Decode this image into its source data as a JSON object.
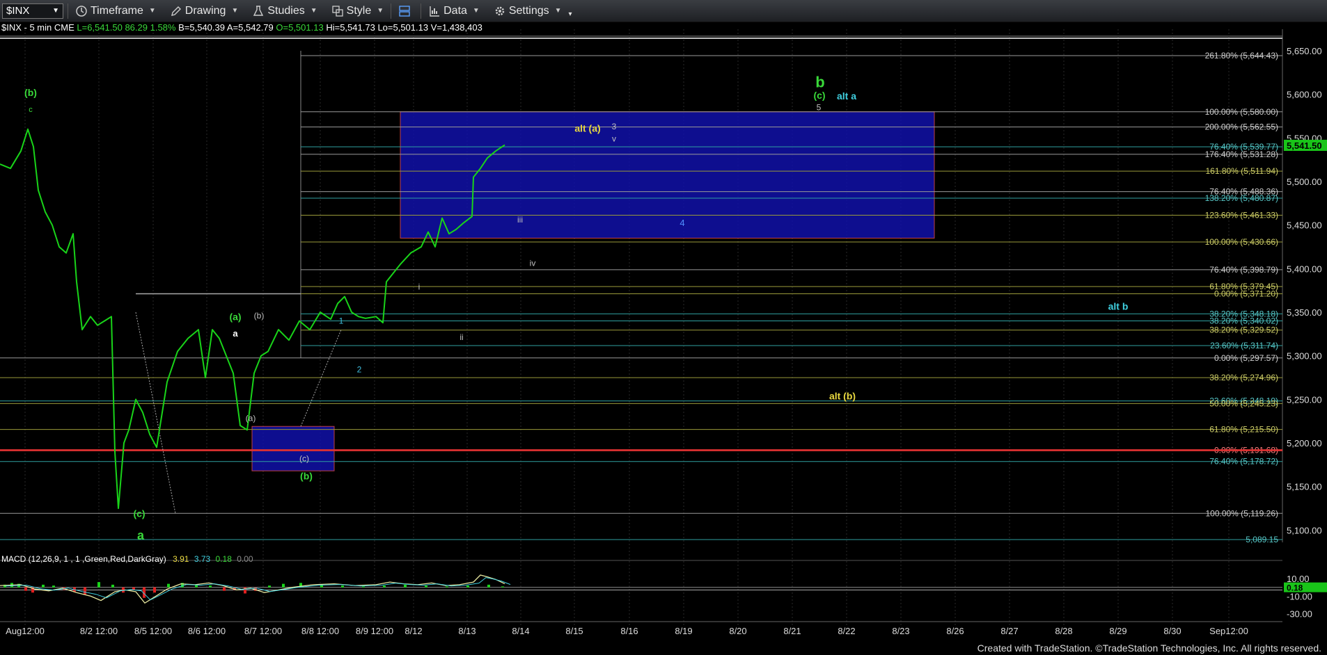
{
  "toolbar": {
    "symbol": "$INX",
    "items": [
      {
        "name": "timeframe",
        "label": "Timeframe",
        "icon": "clock-icon"
      },
      {
        "name": "drawing",
        "label": "Drawing",
        "icon": "pencil-icon"
      },
      {
        "name": "studies",
        "label": "Studies",
        "icon": "flask-icon"
      },
      {
        "name": "style",
        "label": "Style",
        "icon": "style-icon"
      },
      {
        "name": "data",
        "label": "Data",
        "icon": "bar-chart-icon"
      },
      {
        "name": "settings",
        "label": "Settings",
        "icon": "gear-icon"
      }
    ]
  },
  "infobar": {
    "symbol": "$INX - 5 min CME",
    "last": "L=6,541.50",
    "change": "86.29",
    "pct": "1.58%",
    "bid": "B=5,540.39",
    "ask": "A=5,542.79",
    "open": "O=5,501.13",
    "high": "Hi=5,541.73",
    "low": "Lo=5,501.13",
    "vol": "V=1,438,403"
  },
  "macd": {
    "label": "MACD (12,26,9, 1 , 1 ,Green,Red,DarkGray)",
    "v1": "3.91",
    "v2": "3.73",
    "v3": "0.18",
    "v4": "0.00"
  },
  "footer": "Created with TradeStation. ©TradeStation Technologies, Inc. All rights reserved.",
  "chart_data": {
    "type": "line",
    "ylim": [
      5072,
      5668
    ],
    "price_ticks": [
      5100,
      5150,
      5200,
      5250,
      5300,
      5350,
      5400,
      5450,
      5500,
      5550,
      5600,
      5650
    ],
    "price_tick_labels": [
      "5,100.00",
      "5,150.00",
      "5,200.00",
      "5,250.00",
      "5,300.00",
      "5,350.00",
      "5,400.00",
      "5,450.00",
      "5,500.00",
      "5,550.00",
      "5,600.00",
      "5,650.00"
    ],
    "last_price": {
      "value": 5541.5,
      "label": "5,541.50"
    },
    "date_labels": [
      "Aug12:00",
      "8/2 12:00",
      "8/5 12:00",
      "8/6 12:00",
      "8/7 12:00",
      "8/8 12:00",
      "8/9 12:00",
      "8/12",
      "8/13",
      "8/14",
      "8/15",
      "8/16",
      "8/19",
      "8/20",
      "8/21",
      "8/22",
      "8/23",
      "8/26",
      "8/27",
      "8/28",
      "8/29",
      "8/30",
      "Sep12:00"
    ],
    "price_series": [
      [
        0,
        5520
      ],
      [
        15,
        5515
      ],
      [
        30,
        5535
      ],
      [
        40,
        5560
      ],
      [
        48,
        5540
      ],
      [
        55,
        5490
      ],
      [
        65,
        5465
      ],
      [
        75,
        5450
      ],
      [
        85,
        5425
      ],
      [
        95,
        5418
      ],
      [
        105,
        5440
      ],
      [
        110,
        5385
      ],
      [
        118,
        5330
      ],
      [
        130,
        5345
      ],
      [
        140,
        5335
      ],
      [
        150,
        5340
      ],
      [
        160,
        5345
      ],
      [
        165,
        5190
      ],
      [
        170,
        5125
      ],
      [
        178,
        5200
      ],
      [
        185,
        5215
      ],
      [
        195,
        5250
      ],
      [
        205,
        5235
      ],
      [
        215,
        5210
      ],
      [
        225,
        5195
      ],
      [
        240,
        5270
      ],
      [
        255,
        5305
      ],
      [
        270,
        5320
      ],
      [
        285,
        5330
      ],
      [
        295,
        5275
      ],
      [
        305,
        5330
      ],
      [
        315,
        5320
      ],
      [
        325,
        5300
      ],
      [
        335,
        5280
      ],
      [
        345,
        5220
      ],
      [
        355,
        5215
      ],
      [
        365,
        5280
      ],
      [
        375,
        5300
      ],
      [
        385,
        5305
      ],
      [
        400,
        5330
      ],
      [
        415,
        5318
      ],
      [
        430,
        5340
      ],
      [
        445,
        5330
      ],
      [
        460,
        5350
      ],
      [
        475,
        5342
      ],
      [
        485,
        5360
      ],
      [
        495,
        5368
      ],
      [
        505,
        5350
      ],
      [
        515,
        5345
      ],
      [
        525,
        5343
      ],
      [
        540,
        5345
      ],
      [
        550,
        5338
      ],
      [
        555,
        5385
      ],
      [
        565,
        5395
      ],
      [
        575,
        5405
      ],
      [
        590,
        5418
      ],
      [
        605,
        5425
      ],
      [
        615,
        5442
      ],
      [
        625,
        5425
      ],
      [
        635,
        5458
      ],
      [
        645,
        5440
      ],
      [
        655,
        5445
      ],
      [
        665,
        5452
      ],
      [
        678,
        5460
      ],
      [
        680,
        5505
      ],
      [
        690,
        5515
      ],
      [
        700,
        5527
      ],
      [
        712,
        5535
      ],
      [
        725,
        5542
      ]
    ],
    "fib_levels": [
      {
        "label": "261.80% (5,644.43)",
        "value": 5644.43,
        "color": "#9a9a9a"
      },
      {
        "label": "100.00% (5,580.00)",
        "value": 5580.0,
        "color": "#9a9a9a"
      },
      {
        "label": "200.00% (5,562.55)",
        "value": 5562.55,
        "color": "#9a9a9a"
      },
      {
        "label": "76.40% (5,539.77)",
        "value": 5539.77,
        "color": "#2fa0a0"
      },
      {
        "label": "176.40% (5,531.28)",
        "value": 5531.28,
        "color": "#9a9a9a"
      },
      {
        "label": "161.80% (5,511.94)",
        "value": 5511.94,
        "color": "#9a9a3a"
      },
      {
        "label": "76.40% (5,488.36)",
        "value": 5488.36,
        "color": "#9a9a9a"
      },
      {
        "label": "138.20% (5,480.87)",
        "value": 5480.87,
        "color": "#2fa0a0"
      },
      {
        "label": "123.60% (5,461.33)",
        "value": 5461.33,
        "color": "#9a9a3a"
      },
      {
        "label": "100.00% (5,430.66)",
        "value": 5430.66,
        "color": "#9a9a3a"
      },
      {
        "label": "76.40% (5,398.79)",
        "value": 5398.79,
        "color": "#9a9a9a"
      },
      {
        "label": "61.80% (5,379.45)",
        "value": 5379.45,
        "color": "#9a9a3a"
      },
      {
        "label": "0.00% (5,371.20)",
        "value": 5371.2,
        "color": "#9a9a3a"
      },
      {
        "label": "38.20% (5,348.18)",
        "value": 5348.18,
        "color": "#2fa0a0"
      },
      {
        "label": "38.20% (5,340.02)",
        "value": 5340.02,
        "color": "#2fa0a0"
      },
      {
        "label": "38.20% (5,329.52)",
        "value": 5329.52,
        "color": "#9a9a3a"
      },
      {
        "label": "23.60% (5,311.74)",
        "value": 5311.74,
        "color": "#2fa0a0"
      },
      {
        "label": "0.00% (5,297.57)",
        "value": 5297.57,
        "color": "#9a9a9a"
      },
      {
        "label": "38.20% (5,274.96)",
        "value": 5274.96,
        "color": "#9a9a3a"
      },
      {
        "label": "23.60% (5,248.19)",
        "value": 5248.19,
        "color": "#2fa0a0"
      },
      {
        "label": "50.00% (5,245.23)",
        "value": 5245.23,
        "color": "#9a9a3a"
      },
      {
        "label": "61.80% (5,215.50)",
        "value": 5215.5,
        "color": "#9a9a3a"
      },
      {
        "label": "0.00% (5,191.68)",
        "value": 5191.68,
        "color": "#d04040"
      },
      {
        "label": "76.40% (5,178.72)",
        "value": 5178.72,
        "color": "#2fa0a0"
      },
      {
        "label": "100.00% (5,119.26)",
        "value": 5119.26,
        "color": "#9a9a9a"
      },
      {
        "label": "5,089.15",
        "value": 5089.15,
        "color": "#2fa0a0"
      }
    ],
    "boxes": [
      {
        "x0": 575,
        "x1": 1342,
        "y0": 5580,
        "y1": 5435,
        "fill": "#1010a8",
        "stroke": "#c04040"
      },
      {
        "x0": 362,
        "x1": 480,
        "y0": 5219,
        "y1": 5168,
        "fill": "#1010a8",
        "stroke": "#c04040"
      }
    ],
    "annotations": [
      {
        "text": "(b)",
        "x": 44,
        "y": 5598,
        "color": "#39d839",
        "size": 14,
        "bold": true
      },
      {
        "text": "c",
        "x": 44,
        "y": 5580,
        "color": "#39d839",
        "size": 11
      },
      {
        "text": "(a)",
        "x": 338,
        "y": 5341,
        "color": "#39d839",
        "size": 14,
        "bold": true
      },
      {
        "text": "(b)",
        "x": 372,
        "y": 5343,
        "color": "#c0c0c0",
        "size": 12
      },
      {
        "text": "a",
        "x": 338,
        "y": 5322,
        "color": "#ffffff",
        "size": 13,
        "bold": true
      },
      {
        "text": "(a)",
        "x": 360,
        "y": 5225,
        "color": "#c0c0c0",
        "size": 12
      },
      {
        "text": "(c)",
        "x": 437,
        "y": 5179,
        "color": "#c0c0c0",
        "size": 12
      },
      {
        "text": "(b)",
        "x": 440,
        "y": 5158,
        "color": "#39d839",
        "size": 14,
        "bold": true
      },
      {
        "text": "(c)",
        "x": 200,
        "y": 5115,
        "color": "#39d839",
        "size": 14,
        "bold": true
      },
      {
        "text": "a",
        "x": 202,
        "y": 5089,
        "color": "#39d839",
        "size": 18,
        "bold": true
      },
      {
        "text": "1",
        "x": 490,
        "y": 5337,
        "color": "#40c0e0",
        "size": 12
      },
      {
        "text": "2",
        "x": 516,
        "y": 5281,
        "color": "#40c0e0",
        "size": 12
      },
      {
        "text": "i",
        "x": 602,
        "y": 5376,
        "color": "#c0c0c0",
        "size": 12
      },
      {
        "text": "ii",
        "x": 663,
        "y": 5318,
        "color": "#c0c0c0",
        "size": 12
      },
      {
        "text": "iii",
        "x": 747,
        "y": 5453,
        "color": "#c0c0c0",
        "size": 12
      },
      {
        "text": "iv",
        "x": 765,
        "y": 5403,
        "color": "#c0c0c0",
        "size": 12
      },
      {
        "text": "4",
        "x": 980,
        "y": 5449,
        "color": "#5090ff",
        "size": 13
      },
      {
        "text": "alt (a)",
        "x": 844,
        "y": 5557,
        "color": "#e8d840",
        "size": 14,
        "bold": true
      },
      {
        "text": "3",
        "x": 882,
        "y": 5560,
        "color": "#c0c0c0",
        "size": 12
      },
      {
        "text": "v",
        "x": 882,
        "y": 5546,
        "color": "#c0c0c0",
        "size": 12
      },
      {
        "text": "b",
        "x": 1178,
        "y": 5608,
        "color": "#39d839",
        "size": 22,
        "bold": true
      },
      {
        "text": "(c)",
        "x": 1177,
        "y": 5595,
        "color": "#39d839",
        "size": 14,
        "bold": true
      },
      {
        "text": "5",
        "x": 1176,
        "y": 5582,
        "color": "#c0c0c0",
        "size": 12
      },
      {
        "text": "alt a",
        "x": 1216,
        "y": 5594,
        "color": "#40d0e0",
        "size": 14,
        "bold": true
      },
      {
        "text": "alt b",
        "x": 1606,
        "y": 5353,
        "color": "#40d0e0",
        "size": 14,
        "bold": true
      },
      {
        "text": "alt (b)",
        "x": 1210,
        "y": 5250,
        "color": "#e8d840",
        "size": 14,
        "bold": true
      }
    ],
    "macd": {
      "y_ticks": [
        10,
        -10,
        -30
      ],
      "y_tick_labels": [
        "10.00",
        "-10.00",
        "-30.00"
      ],
      "last_value_label": "0.18",
      "ylim": [
        -36,
        18
      ]
    }
  }
}
